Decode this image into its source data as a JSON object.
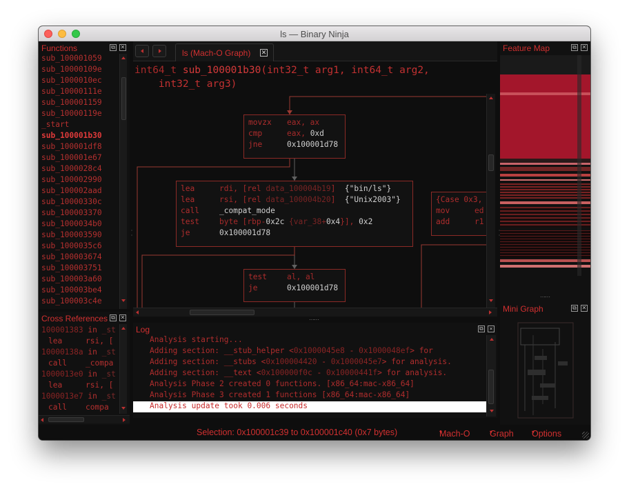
{
  "window": {
    "title": "ls — Binary Ninja"
  },
  "functions_panel": {
    "title": "Functions",
    "items": [
      "sub_100001059",
      "sub_10000109e",
      "sub_1000010ec",
      "sub_10000111e",
      "sub_100001159",
      "sub_10000119e",
      "_start",
      "sub_100001b30",
      "sub_100001df8",
      "sub_100001e67",
      "sub_1000028c4",
      "sub_100002990",
      "sub_100002aad",
      "sub_10000330c",
      "sub_100003370",
      "sub_1000034b0",
      "sub_100003590",
      "sub_1000035c6",
      "sub_100003674",
      "sub_100003751",
      "sub_100003a60",
      "sub_100003be4",
      "sub_100003c4e"
    ],
    "selected_index": 7
  },
  "xrefs_panel": {
    "title": "Cross References",
    "rows": [
      {
        "addr": "100001383",
        "in": "in",
        "fn": "_st",
        "op": "lea",
        "args": "rsi, ["
      },
      {
        "addr": "10000138a",
        "in": "in",
        "fn": "_st",
        "op": "call",
        "args": "_compa"
      },
      {
        "addr": "1000013e0",
        "in": "in",
        "fn": "_st",
        "op": "lea",
        "args": "rsi, ["
      },
      {
        "addr": "1000013e7",
        "in": "in",
        "fn": "_st",
        "op": "call",
        "args": "compa"
      }
    ]
  },
  "tab": {
    "label": "ls (Mach-O Graph)"
  },
  "signature": {
    "ret": "int64_t",
    "name": "sub_100001b30",
    "line1_args": "(int32_t arg1, int64_t arg2,",
    "line2_args": "int32_t arg3)"
  },
  "blocks": {
    "b1": [
      {
        "m": "movzx",
        "a": "eax, ax"
      },
      {
        "m": "cmp",
        "a": "eax, ",
        "n": "0xd"
      },
      {
        "m": "jne",
        "n": "0x100001d78"
      }
    ],
    "b2": [
      {
        "m": "lea",
        "a": "rdi, [rel ",
        "d": "data_100004b19",
        "t": "]  ",
        "s": "{\"bin/ls\"}"
      },
      {
        "m": "lea",
        "a": "rsi, [rel ",
        "d": "data_100004b20",
        "t": "]  ",
        "s": "{\"Unix2003\"}"
      },
      {
        "m": "call",
        "n": "_compat_mode"
      },
      {
        "m": "test",
        "a": "byte [rbp-",
        "n2": "0x2c",
        "d": " {var_38+",
        "n3": "0x4",
        "t": "}], ",
        "n": "0x2"
      },
      {
        "m": "je",
        "n": "0x100001d78"
      }
    ],
    "b3": [
      {
        "m": "test",
        "a": "al, al"
      },
      {
        "m": "je",
        "n": "0x100001d78"
      }
    ],
    "b4": [
      {
        "m": "{Case 0x3,",
        "a": ""
      },
      {
        "m": "mov",
        "a": "ed"
      },
      {
        "m": "add",
        "a": "r1"
      }
    ]
  },
  "log": {
    "title": "Log",
    "lines": [
      {
        "pre": "Analysis starting...",
        "a1": "",
        "mid": "",
        "a2": "",
        "post": ""
      },
      {
        "pre": "Adding section: __stub_helper <",
        "a1": "0x1000045e8",
        "mid": " - ",
        "a2": "0x1000048ef",
        "post": "> for"
      },
      {
        "pre": "Adding section: __stubs <",
        "a1": "0x100004420",
        "mid": " - ",
        "a2": "0x1000045e7",
        "post": "> for analysis."
      },
      {
        "pre": "Adding section: __text <",
        "a1": "0x100000f0c",
        "mid": " - ",
        "a2": "0x10000441f",
        "post": "> for analysis."
      },
      {
        "pre": "Analysis Phase 2 created 0 functions. [x86_64:mac-x86_64]",
        "a1": "",
        "mid": "",
        "a2": "",
        "post": ""
      },
      {
        "pre": "Analysis Phase 3 created 1 functions [x86_64:mac-x86_64]",
        "a1": "",
        "mid": "",
        "a2": "",
        "post": ""
      },
      {
        "pre": "Analysis update took 0.006 seconds",
        "a1": "",
        "mid": "",
        "a2": "",
        "post": ""
      }
    ]
  },
  "feature_map": {
    "title": "Feature Map"
  },
  "mini_graph": {
    "title": "Mini Graph"
  },
  "status": {
    "selection": "Selection: 0x100001c39 to 0x100001c40 (0x7 bytes)",
    "platform": "Mach-O",
    "view": "Graph",
    "options": "Options",
    "caret": "▾"
  },
  "colors": {
    "accent": "#d23030",
    "background": "#0e0e0e",
    "block_border": "#8c2a26",
    "feature_red": "#a3162b"
  }
}
